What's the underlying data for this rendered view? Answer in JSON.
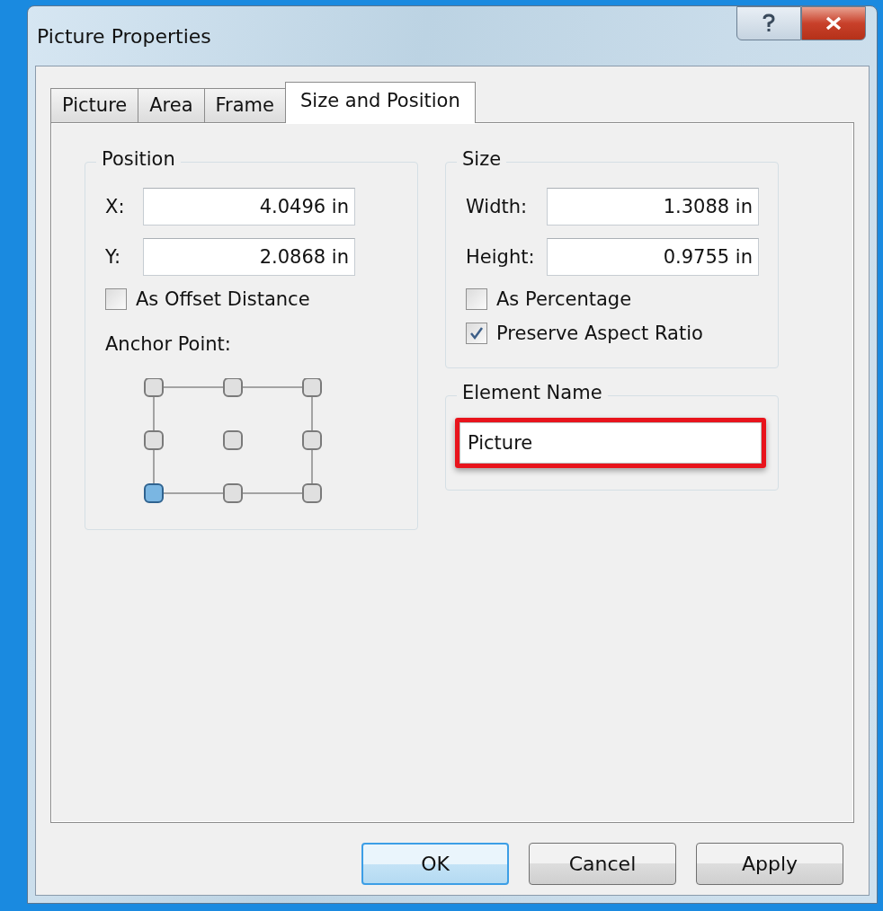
{
  "window": {
    "title": "Picture Properties"
  },
  "tabs": [
    {
      "label": "Picture",
      "selected": false
    },
    {
      "label": "Area",
      "selected": false
    },
    {
      "label": "Frame",
      "selected": false
    },
    {
      "label": "Size and Position",
      "selected": true
    }
  ],
  "position": {
    "title": "Position",
    "fields": [
      {
        "label": "X:",
        "value": "4.0496 in"
      },
      {
        "label": "Y:",
        "value": "2.0868 in"
      }
    ],
    "offset_checkbox": {
      "label": "As Offset Distance",
      "checked": false
    },
    "anchor_label": "Anchor Point:",
    "anchor_points": [
      {
        "selected": false
      },
      {
        "selected": false
      },
      {
        "selected": false
      },
      {
        "selected": false
      },
      {
        "selected": false
      },
      {
        "selected": false
      },
      {
        "selected": true
      },
      {
        "selected": false
      },
      {
        "selected": false
      }
    ]
  },
  "size": {
    "title": "Size",
    "fields": [
      {
        "label": "Width:",
        "value": "1.3088 in"
      },
      {
        "label": "Height:",
        "value": "0.9755 in"
      }
    ],
    "checkboxes": [
      {
        "label": "As Percentage",
        "checked": false
      },
      {
        "label": "Preserve Aspect Ratio",
        "checked": true
      }
    ]
  },
  "element_name": {
    "title": "Element Name",
    "value": "Picture",
    "highlighted": true
  },
  "buttons": [
    {
      "label": "OK",
      "default": true
    },
    {
      "label": "Cancel",
      "default": false
    },
    {
      "label": "Apply",
      "default": false
    }
  ]
}
